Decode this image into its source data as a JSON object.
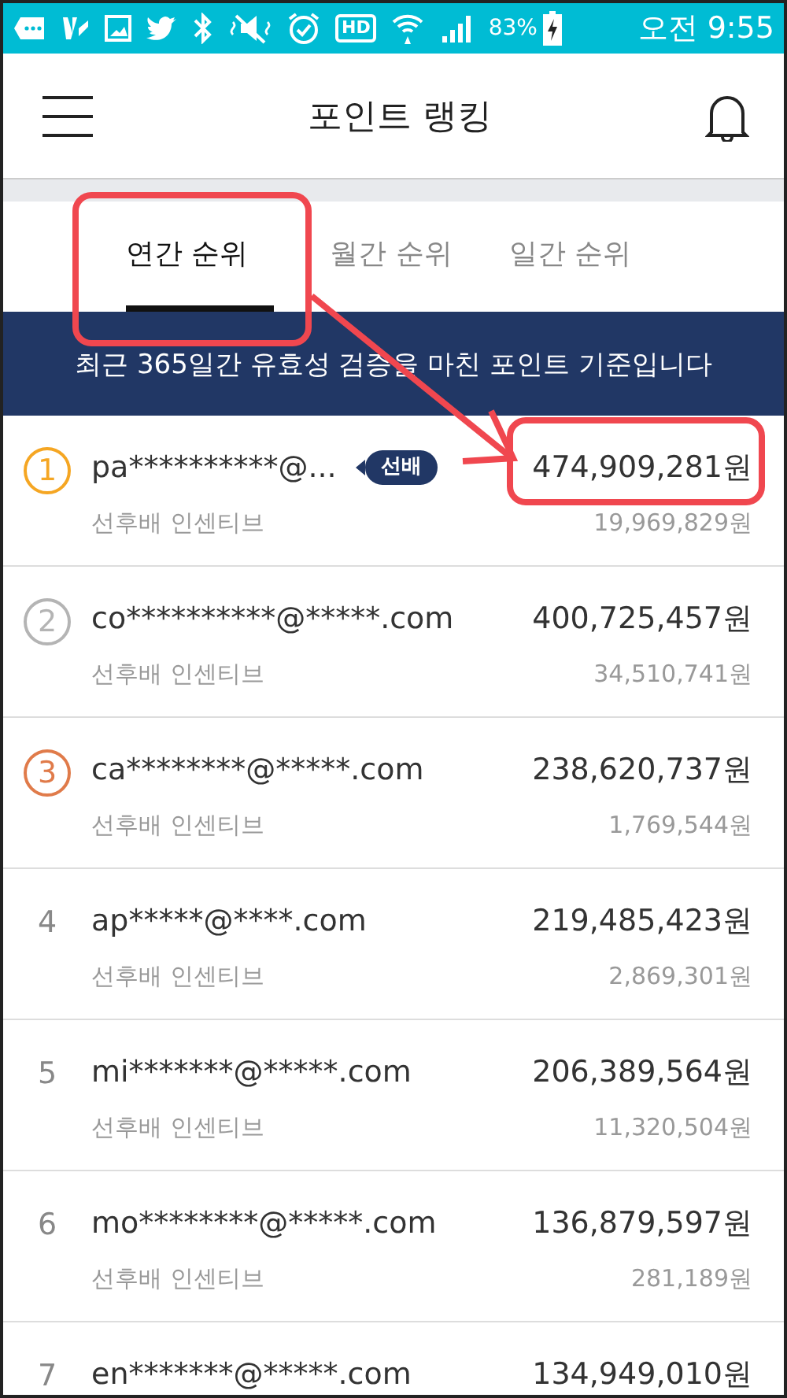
{
  "status_bar": {
    "hd_badge": "HD",
    "battery": "83%",
    "time": "오전 9:55"
  },
  "header": {
    "title": "포인트 랭킹"
  },
  "tabs": [
    {
      "label": "연간 순위",
      "selected": true
    },
    {
      "label": "월간 순위",
      "selected": false
    },
    {
      "label": "일간 순위",
      "selected": false
    }
  ],
  "banner": "최근 365일간 유효성 검증을 마친 포인트 기준입니다",
  "rankings": [
    {
      "rank": "1",
      "kind": "medal",
      "color": "#f5a623",
      "email": "pa**********@...",
      "badge": "선배",
      "amount": "474,909,281원",
      "sub_label": "선후배 인센티브",
      "sub_amount": "19,969,829원"
    },
    {
      "rank": "2",
      "kind": "medal",
      "color": "#b4b4b4",
      "email": "co**********@*****.com",
      "amount": "400,725,457원",
      "sub_label": "선후배 인센티브",
      "sub_amount": "34,510,741원"
    },
    {
      "rank": "3",
      "kind": "medal",
      "color": "#e07b4a",
      "email": "ca********@*****.com",
      "amount": "238,620,737원",
      "sub_label": "선후배 인센티브",
      "sub_amount": "1,769,544원"
    },
    {
      "rank": "4",
      "kind": "plain",
      "email": "ap*****@****.com",
      "amount": "219,485,423원",
      "sub_label": "선후배 인센티브",
      "sub_amount": "2,869,301원"
    },
    {
      "rank": "5",
      "kind": "plain",
      "email": "mi*******@*****.com",
      "amount": "206,389,564원",
      "sub_label": "선후배 인센티브",
      "sub_amount": "11,320,504원"
    },
    {
      "rank": "6",
      "kind": "plain",
      "email": "mo********@*****.com",
      "amount": "136,879,597원",
      "sub_label": "선후배 인센티브",
      "sub_amount": "281,189원"
    },
    {
      "rank": "7",
      "kind": "plain",
      "email": "en*******@*****.com",
      "amount": "134,949,010원"
    }
  ]
}
